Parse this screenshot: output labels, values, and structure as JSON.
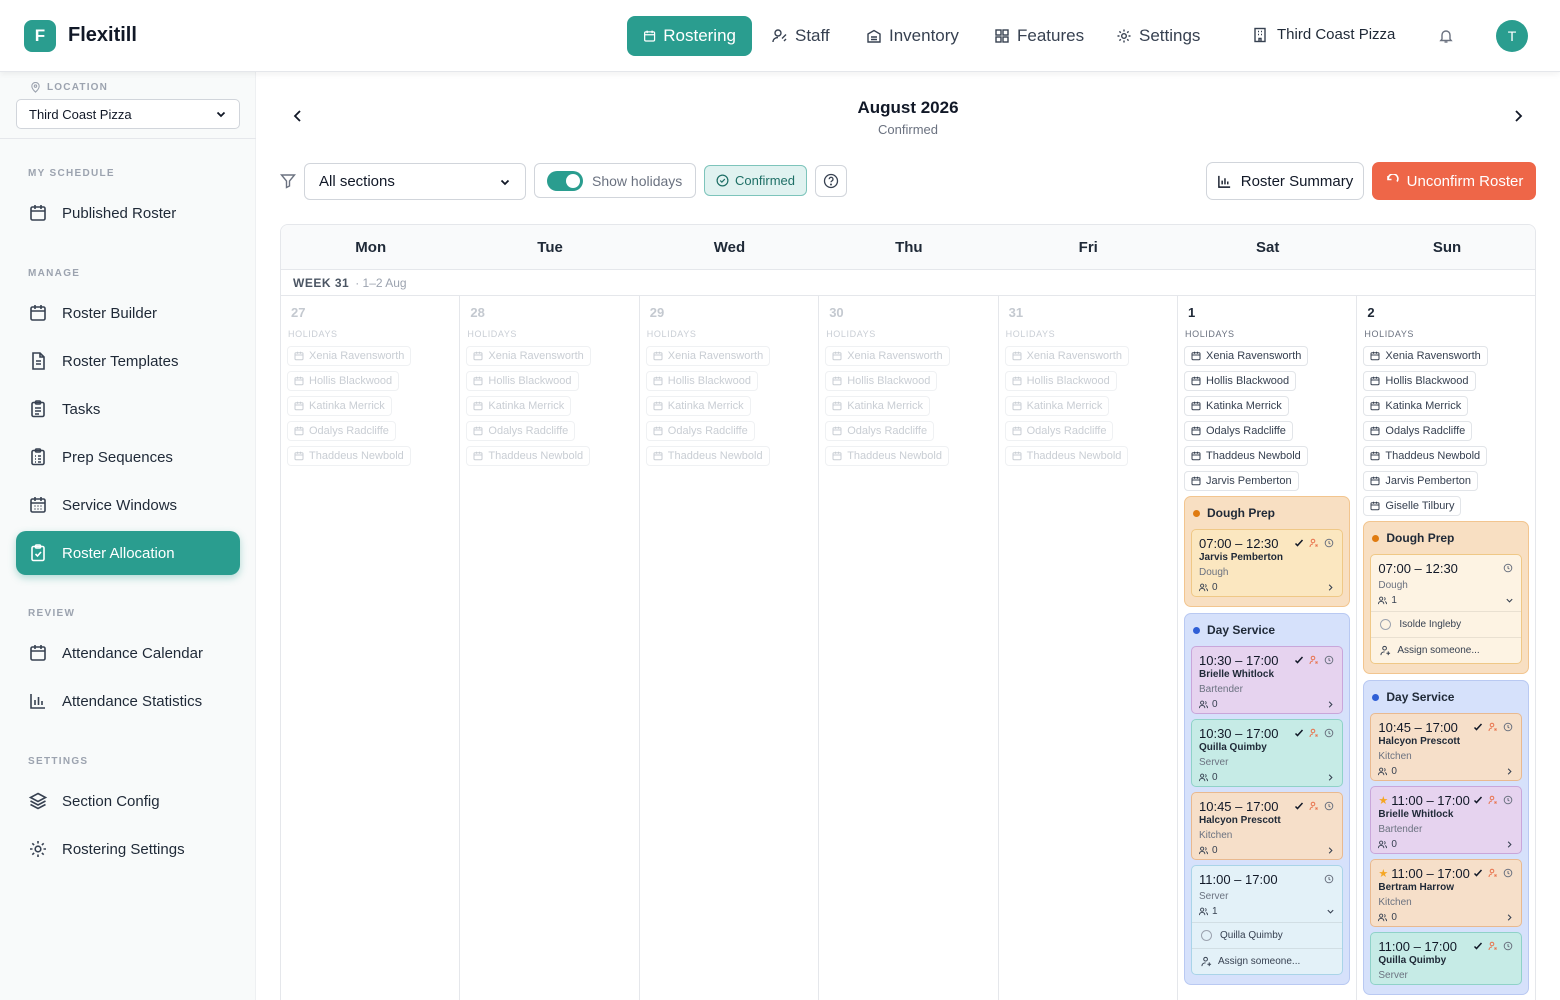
{
  "app": {
    "logo_letter": "F",
    "name": "Flexitill"
  },
  "nav": [
    {
      "label": "Rostering",
      "icon": "calendar-icon",
      "active": true
    },
    {
      "label": "Staff",
      "icon": "staff-icon"
    },
    {
      "label": "Inventory",
      "icon": "inventory-icon"
    },
    {
      "label": "Features",
      "icon": "grid-icon"
    },
    {
      "label": "Settings",
      "icon": "gear-icon"
    }
  ],
  "org": {
    "name": "Third Coast Pizza"
  },
  "user": {
    "initial": "T"
  },
  "sidebar": {
    "location_label": "LOCATION",
    "location_value": "Third Coast Pizza",
    "sections": {
      "my_schedule": "MY SCHEDULE",
      "manage": "MANAGE",
      "review": "REVIEW",
      "settings": "SETTINGS"
    },
    "items": {
      "published_roster": "Published Roster",
      "roster_builder": "Roster Builder",
      "roster_templates": "Roster Templates",
      "tasks": "Tasks",
      "prep_sequences": "Prep Sequences",
      "service_windows": "Service Windows",
      "roster_allocation": "Roster Allocation",
      "attendance_calendar": "Attendance Calendar",
      "attendance_statistics": "Attendance Statistics",
      "section_config": "Section Config",
      "rostering_settings": "Rostering Settings"
    }
  },
  "header": {
    "month": "August 2026",
    "status": "Confirmed"
  },
  "toolbar": {
    "sections_value": "All sections",
    "show_holidays": "Show holidays",
    "confirmed_badge": "Confirmed",
    "roster_summary": "Roster Summary",
    "unconfirm": "Unconfirm Roster"
  },
  "calendar": {
    "days": [
      "Mon",
      "Tue",
      "Wed",
      "Thu",
      "Fri",
      "Sat",
      "Sun"
    ],
    "week_label": "WEEK 31",
    "week_range": "· 1–2 Aug",
    "holidays_label": "HOLIDAYS",
    "dates": [
      "27",
      "28",
      "29",
      "30",
      "31",
      "1",
      "2"
    ],
    "muted_holidays": [
      "Xenia Ravensworth",
      "Hollis Blackwood",
      "Katinka Merrick",
      "Odalys Radcliffe",
      "Thaddeus Newbold"
    ],
    "sat_holidays": [
      "Xenia Ravensworth",
      "Hollis Blackwood",
      "Katinka Merrick",
      "Odalys Radcliffe",
      "Thaddeus Newbold",
      "Jarvis Pemberton"
    ],
    "sun_holidays": [
      "Xenia Ravensworth",
      "Hollis Blackwood",
      "Katinka Merrick",
      "Odalys Radcliffe",
      "Thaddeus Newbold",
      "Jarvis Pemberton",
      "Giselle Tilbury"
    ],
    "groups": {
      "dough": "Dough Prep",
      "service": "Day Service"
    },
    "sat_shifts": {
      "dough1": {
        "time": "07:00 – 12:30",
        "name": "Jarvis Pemberton",
        "role": "Dough",
        "count": "0"
      },
      "svc1": {
        "time": "10:30 – 17:00",
        "name": "Brielle Whitlock",
        "role": "Bartender",
        "count": "0"
      },
      "svc2": {
        "time": "10:30 – 17:00",
        "name": "Quilla Quimby",
        "role": "Server",
        "count": "0"
      },
      "svc3": {
        "time": "10:45 – 17:00",
        "name": "Halcyon Prescott",
        "role": "Kitchen",
        "count": "0"
      },
      "svc4": {
        "time": "11:00 – 17:00",
        "role": "Server",
        "count": "1",
        "assignee": "Quilla Quimby",
        "assign": "Assign someone..."
      }
    },
    "sun_shifts": {
      "dough1": {
        "time": "07:00 – 12:30",
        "role": "Dough",
        "count": "1",
        "assignee": "Isolde Ingleby",
        "assign": "Assign someone..."
      },
      "svc1": {
        "time": "10:45 – 17:00",
        "name": "Halcyon Prescott",
        "role": "Kitchen",
        "count": "0"
      },
      "svc2": {
        "time": "11:00 – 17:00",
        "name": "Brielle Whitlock",
        "role": "Bartender",
        "count": "0"
      },
      "svc3": {
        "time": "11:00 – 17:00",
        "name": "Bertram Harrow",
        "role": "Kitchen",
        "count": "0"
      },
      "svc4": {
        "time": "11:00 – 17:00",
        "name": "Quilla Quimby",
        "role": "Server"
      }
    }
  },
  "colors": {
    "brand": "#2a9d8f",
    "danger": "#ee6648",
    "dough_dot": "#e07b10",
    "service_dot": "#2f5fd6"
  }
}
